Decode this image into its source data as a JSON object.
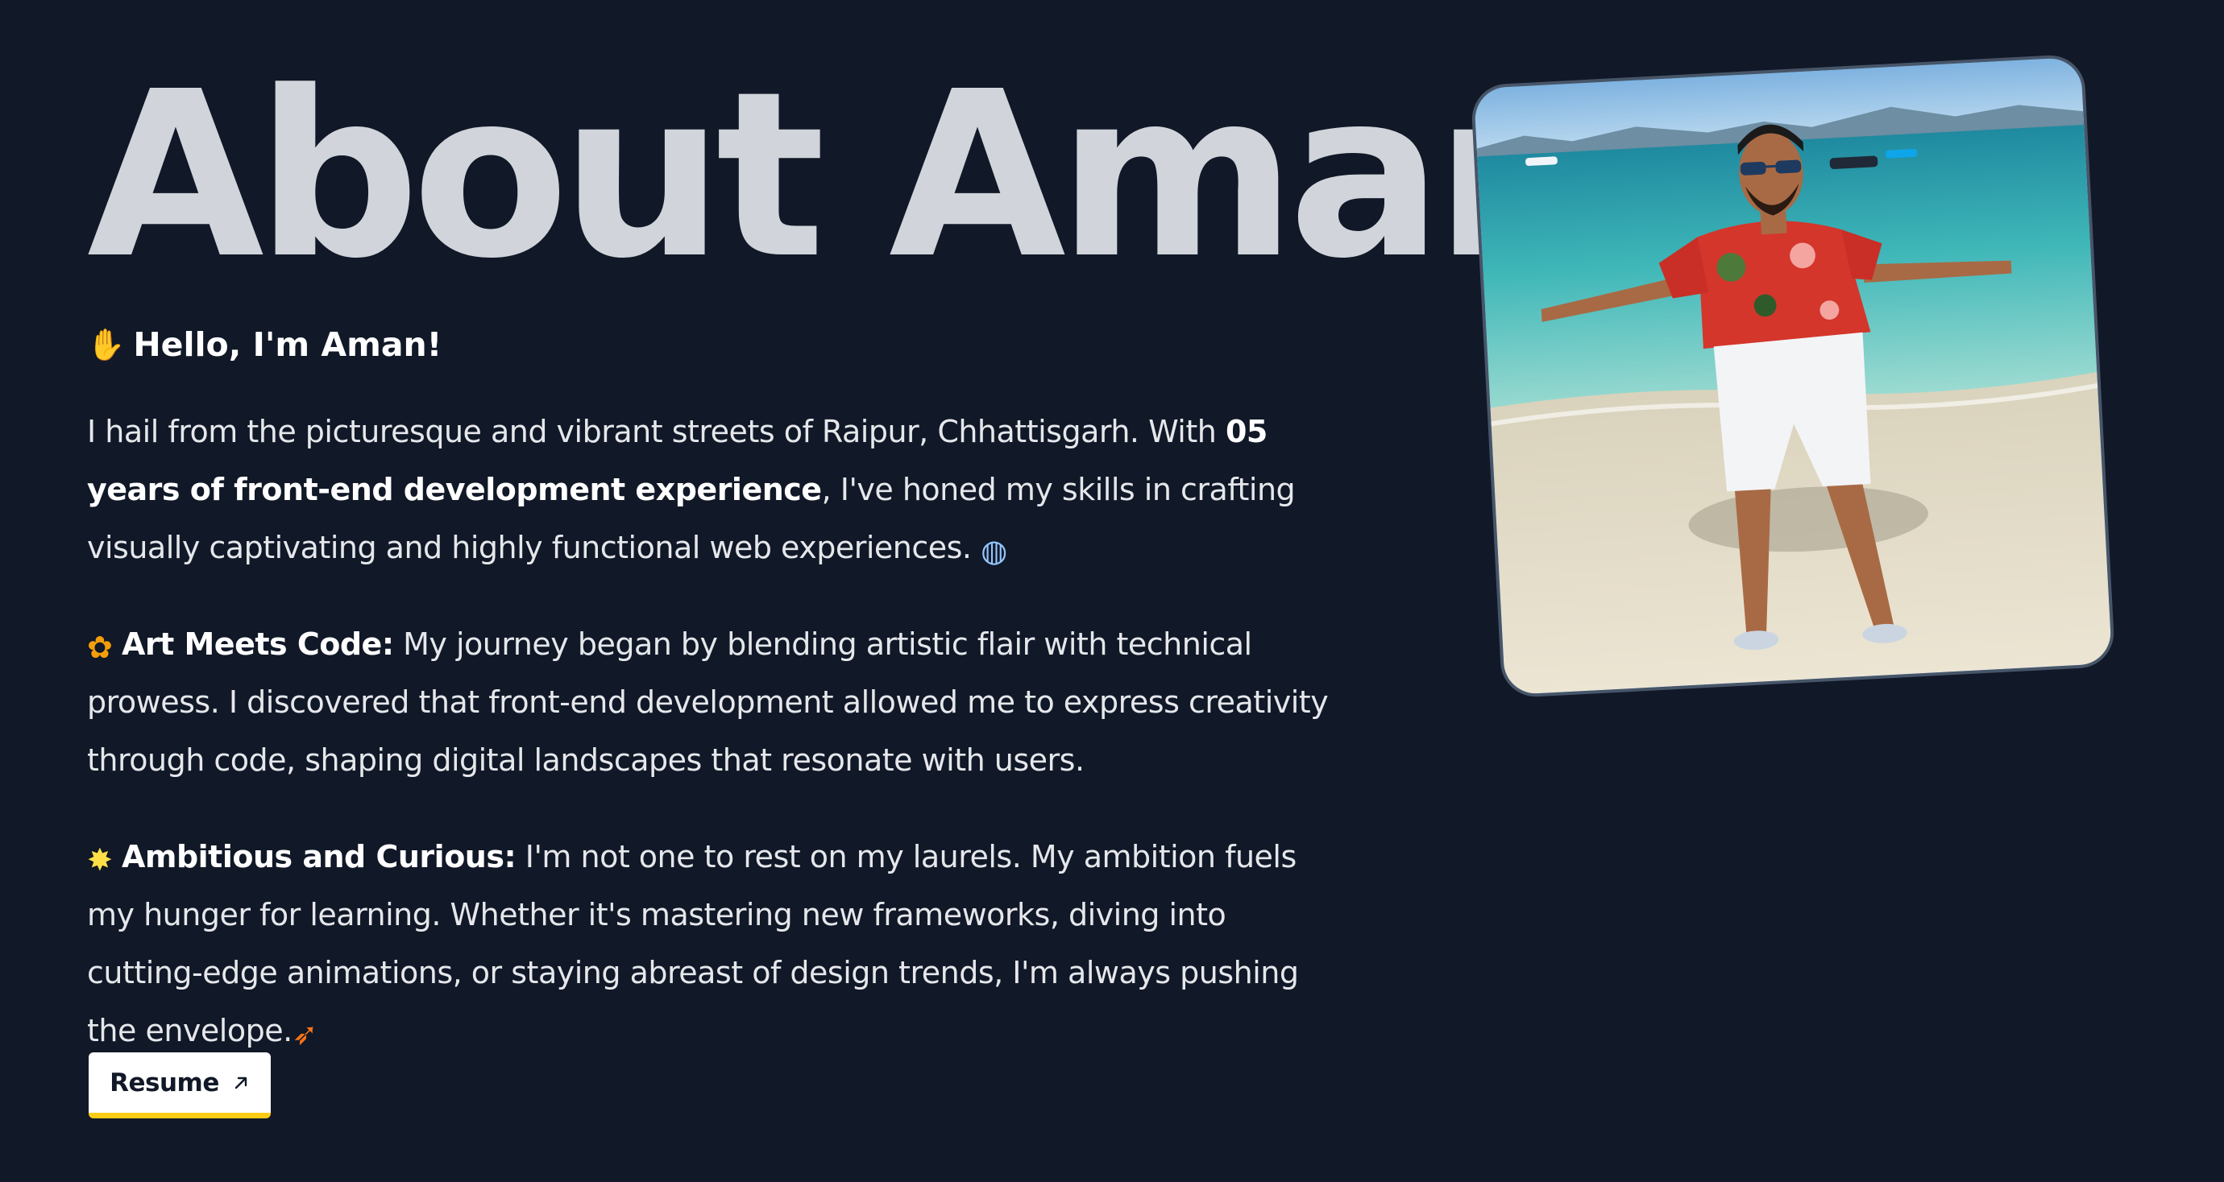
{
  "page": {
    "title": "About Aman"
  },
  "intro": {
    "emoji": "wave-emoji",
    "greeting": "Hello, I'm Aman!"
  },
  "paragraph_1": {
    "text_before": "I hail from the picturesque and vibrant streets of Raipur, Chhattisgarh. With ",
    "bold": "05 years of front-end development experience",
    "text_after": ", I've honed my skills in crafting visually captivating and highly functional web experiences. ",
    "end_emoji": "globe-emoji"
  },
  "paragraph_2": {
    "emoji": "palette-emoji",
    "heading": "Art Meets Code:",
    "text": " My journey began by blending artistic flair with technical prowess. I discovered that front-end development allowed me to express creativity through code, shaping digital landscapes that resonate with users."
  },
  "paragraph_3": {
    "emoji": "star-emoji",
    "heading": "Ambitious and Curious:",
    "text": " I'm not one to rest on my laurels. My ambition fuels my hunger for learning. Whether it's mastering new frameworks, diving into cutting-edge animations, or staying abreast of design trends, I'm always pushing the envelope.",
    "end_emoji": "rocket-emoji"
  },
  "resume_button": {
    "label": "Resume",
    "icon": "arrow-up-right-icon"
  },
  "photo": {
    "subject": "profile-photo"
  },
  "colors": {
    "background": "#111827",
    "title": "#d1d5db",
    "text": "#e5e7eb",
    "button_bg": "#ffffff",
    "button_accent": "#facc15",
    "photo_border": "#475569"
  }
}
